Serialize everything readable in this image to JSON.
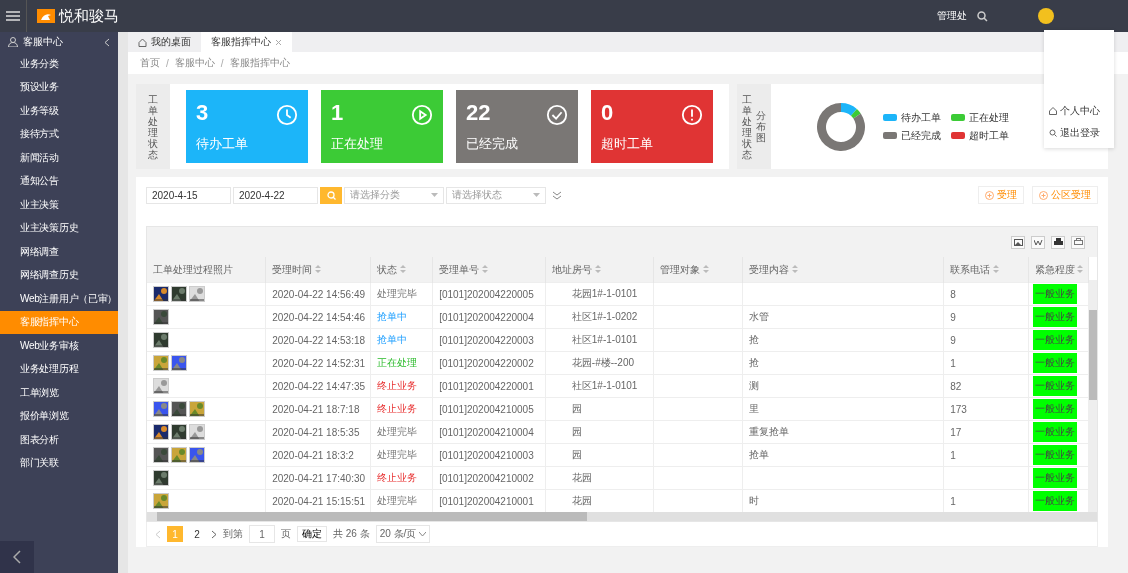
{
  "topbar": {
    "brand": "悦和骏马",
    "org": "管理处"
  },
  "user_menu": [
    {
      "label": "个人中心",
      "kind": "home"
    },
    {
      "label": "退出登录",
      "kind": "search"
    }
  ],
  "sidebar": {
    "section": "客服中心",
    "items": [
      {
        "label": "业务分类",
        "selected": false
      },
      {
        "label": "预设业务",
        "selected": false
      },
      {
        "label": "业务等级",
        "selected": false
      },
      {
        "label": "接待方式",
        "selected": false
      },
      {
        "label": "新闻活动",
        "selected": false
      },
      {
        "label": "通知公告",
        "selected": false
      },
      {
        "label": "业主决策",
        "selected": false
      },
      {
        "label": "业主决策历史",
        "selected": false
      },
      {
        "label": "网络调查",
        "selected": false
      },
      {
        "label": "网络调查历史",
        "selected": false
      },
      {
        "label": "Web注册用户（已审）",
        "selected": false
      },
      {
        "label": "客服指挥中心",
        "selected": true
      },
      {
        "label": "Web业务审核",
        "selected": false
      },
      {
        "label": "业务处理历程",
        "selected": false
      },
      {
        "label": "工单浏览",
        "selected": false
      },
      {
        "label": "报价单浏览",
        "selected": false
      },
      {
        "label": "图表分析",
        "selected": false
      },
      {
        "label": "部门关联",
        "selected": false
      }
    ]
  },
  "tabs": [
    {
      "label": "我的桌面",
      "selected": false,
      "closable": false
    },
    {
      "label": "客服指挥中心",
      "selected": true,
      "closable": true
    }
  ],
  "breadcrumb": [
    {
      "label": "首页",
      "kind": "link"
    },
    {
      "label": "/",
      "kind": "separator"
    },
    {
      "label": "客服中心",
      "kind": "link"
    },
    {
      "label": "/",
      "kind": "separator"
    },
    {
      "label": "客服指挥中心",
      "kind": "link"
    }
  ],
  "status_panel": {
    "title": "工单处理状态",
    "cards": [
      {
        "count": "3",
        "label": "待办工单",
        "color": "#1cb5f9",
        "kind": "clock"
      },
      {
        "count": "1",
        "label": "正在处理",
        "color": "#3ccb36",
        "kind": "play"
      },
      {
        "count": "22",
        "label": "已经完成",
        "color": "#7a7775",
        "kind": "check"
      },
      {
        "count": "0",
        "label": "超时工单",
        "color": "#e03434",
        "kind": "alert"
      }
    ]
  },
  "distribution_panel": {
    "title": "工单处理状态",
    "subtitle": "分布图",
    "chart_data": {
      "type": "donut",
      "categories": [
        "待办工单",
        "正在处理",
        "已经完成",
        "超时工单"
      ],
      "values": [
        11.5,
        3.9,
        84.6,
        0
      ],
      "colors": [
        "#1cb5f9",
        "#3ccb36",
        "#7a7775",
        "#e03434"
      ]
    }
  },
  "filters": {
    "date_from": "2020-4-15",
    "date_to": "2020-4-22",
    "category_placeholder": "请选择分类",
    "status_placeholder": "请选择状态"
  },
  "actions": [
    "受理",
    "公区受理"
  ],
  "table": {
    "columns": [
      "工单处理过程照片",
      "受理时间",
      "状态",
      "受理单号",
      "地址房号",
      "管理对象",
      "受理内容",
      "联系电话",
      "紧急程度"
    ],
    "rows": [
      {
        "time": "2020-04-22 14:56:49",
        "status": "处理完毕",
        "kind": "done",
        "number": "[0101]202004220005",
        "address": "花园1#-1-0101",
        "content": "",
        "phone": "8",
        "urgency": "一般业务"
      },
      {
        "time": "2020-04-22 14:54:46",
        "status": "抢单中",
        "kind": "grab",
        "number": "[0101]202004220004",
        "address": "社区1#-1-0202",
        "content": "水管",
        "phone": "9",
        "urgency": "一般业务"
      },
      {
        "time": "2020-04-22 14:53:18",
        "status": "抢单中",
        "kind": "grab",
        "number": "[0101]202004220003",
        "address": "社区1#-1-0101",
        "content": "抢",
        "phone": "9",
        "urgency": "一般业务"
      },
      {
        "time": "2020-04-22 14:52:31",
        "status": "正在处理",
        "kind": "doing",
        "number": "[0101]202004220002",
        "address": "花园-#楼--200",
        "content": "抢",
        "phone": "1",
        "urgency": "一般业务"
      },
      {
        "time": "2020-04-22 14:47:35",
        "status": "终止业务",
        "kind": "stop",
        "number": "[0101]202004220001",
        "address": "社区1#-1-0101",
        "content": "测",
        "phone": "82",
        "urgency": "一般业务"
      },
      {
        "time": "2020-04-21 18:7:18",
        "status": "终止业务",
        "kind": "stop",
        "number": "[0101]202004210005",
        "address": "园",
        "content": "里",
        "phone": "173",
        "urgency": "一般业务"
      },
      {
        "time": "2020-04-21 18:5:35",
        "status": "处理完毕",
        "kind": "done",
        "number": "[0101]202004210004",
        "address": "园",
        "content": "重复抢单",
        "phone": "17",
        "urgency": "一般业务"
      },
      {
        "time": "2020-04-21 18:3:2",
        "status": "处理完毕",
        "kind": "done",
        "number": "[0101]202004210003",
        "address": "园",
        "content": "抢单",
        "phone": "1",
        "urgency": "一般业务"
      },
      {
        "time": "2020-04-21 17:40:30",
        "status": "终止业务",
        "kind": "stop",
        "number": "[0101]202004210002",
        "address": "花园",
        "content": "",
        "phone": "",
        "urgency": "一般业务"
      },
      {
        "time": "2020-04-21 15:15:51",
        "status": "处理完毕",
        "kind": "done",
        "number": "[0101]202004210001",
        "address": "花园",
        "content": "时",
        "phone": "1",
        "urgency": "一般业务"
      }
    ]
  },
  "pagination": {
    "pages": [
      {
        "label": "1",
        "selected": true
      },
      {
        "label": "2",
        "selected": false
      }
    ],
    "goto_label": "到第",
    "goto_value": "1",
    "page_unit": "页",
    "confirm": "确定",
    "total": "共 26 条",
    "page_size": "20 条/页"
  }
}
